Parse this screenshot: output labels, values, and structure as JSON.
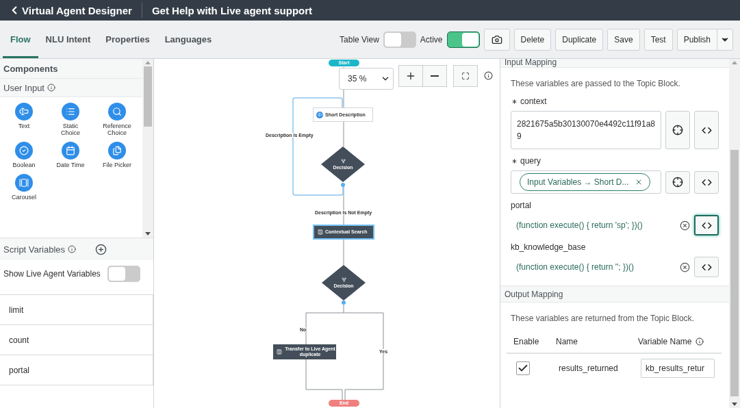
{
  "header": {
    "back_label": "Virtual Agent Designer",
    "title": "Get Help with Live agent support"
  },
  "tabs": [
    {
      "label": "Flow",
      "selected": true
    },
    {
      "label": "NLU Intent",
      "selected": false
    },
    {
      "label": "Properties",
      "selected": false
    },
    {
      "label": "Languages",
      "selected": false
    }
  ],
  "toolbar": {
    "toggles": [
      {
        "label": "Table View",
        "on": false
      },
      {
        "label": "Active",
        "on": true
      }
    ],
    "buttons": [
      "Delete",
      "Duplicate",
      "Save",
      "Test",
      "Publish"
    ]
  },
  "components": {
    "title": "Components",
    "section": "User Input",
    "items": [
      {
        "label": "Text",
        "kind": "text"
      },
      {
        "label": "Static Choice",
        "kind": "list"
      },
      {
        "label": "Reference Choice",
        "kind": "search"
      },
      {
        "label": "Boolean",
        "kind": "boolean"
      },
      {
        "label": "Date Time",
        "kind": "calendar"
      },
      {
        "label": "File Picker",
        "kind": "files"
      },
      {
        "label": "Carousel",
        "kind": "carousel"
      }
    ]
  },
  "script_variables": {
    "title": "Script Variables",
    "show_live_agent": {
      "label": "Show Live Agent Variables",
      "on": false
    },
    "items": [
      "limit",
      "count",
      "portal"
    ]
  },
  "canvas": {
    "zoom": "35 %",
    "nodes": [
      {
        "kind": "start",
        "label": "Start",
        "selected": false
      },
      {
        "kind": "input",
        "label": "Short Description",
        "selected": false
      },
      {
        "kind": "decision",
        "label": "Decision",
        "selected": false
      },
      {
        "kind": "action",
        "label": "Contextual Search",
        "selected": true
      },
      {
        "kind": "decision",
        "label": "Decision",
        "selected": false
      },
      {
        "kind": "action",
        "label": "Transfer to Live Agent duplicate",
        "selected": false
      },
      {
        "kind": "end",
        "label": "End",
        "selected": false
      }
    ],
    "edge_labels": [
      "Description Is Empty",
      "Description Is Not Empty",
      "No",
      "Yes"
    ]
  },
  "input_mapping": {
    "title": "Input Mapping",
    "description": "These variables are passed to the Topic Block.",
    "fields": [
      {
        "kind": "text",
        "name": "context",
        "required": true,
        "value": "2821675a5b30130070e4492c11f91a89",
        "focused": false
      },
      {
        "kind": "pill",
        "name": "query",
        "required": true,
        "value": "Input Variables → Short D...",
        "focused": false
      },
      {
        "kind": "script",
        "name": "portal",
        "required": false,
        "value": "(function execute() { return 'sp'; })()",
        "focused": true
      },
      {
        "kind": "script",
        "name": "kb_knowledge_base",
        "required": false,
        "value": "(function execute() { return ''; })()",
        "focused": false
      }
    ]
  },
  "output_mapping": {
    "title": "Output Mapping",
    "description": "These variables are returned from the Topic Block.",
    "columns": [
      "Enable",
      "Name",
      "Variable Name"
    ],
    "rows": [
      {
        "enabled": true,
        "name": "results_returned",
        "variable": "kb_results_retur"
      }
    ]
  }
}
